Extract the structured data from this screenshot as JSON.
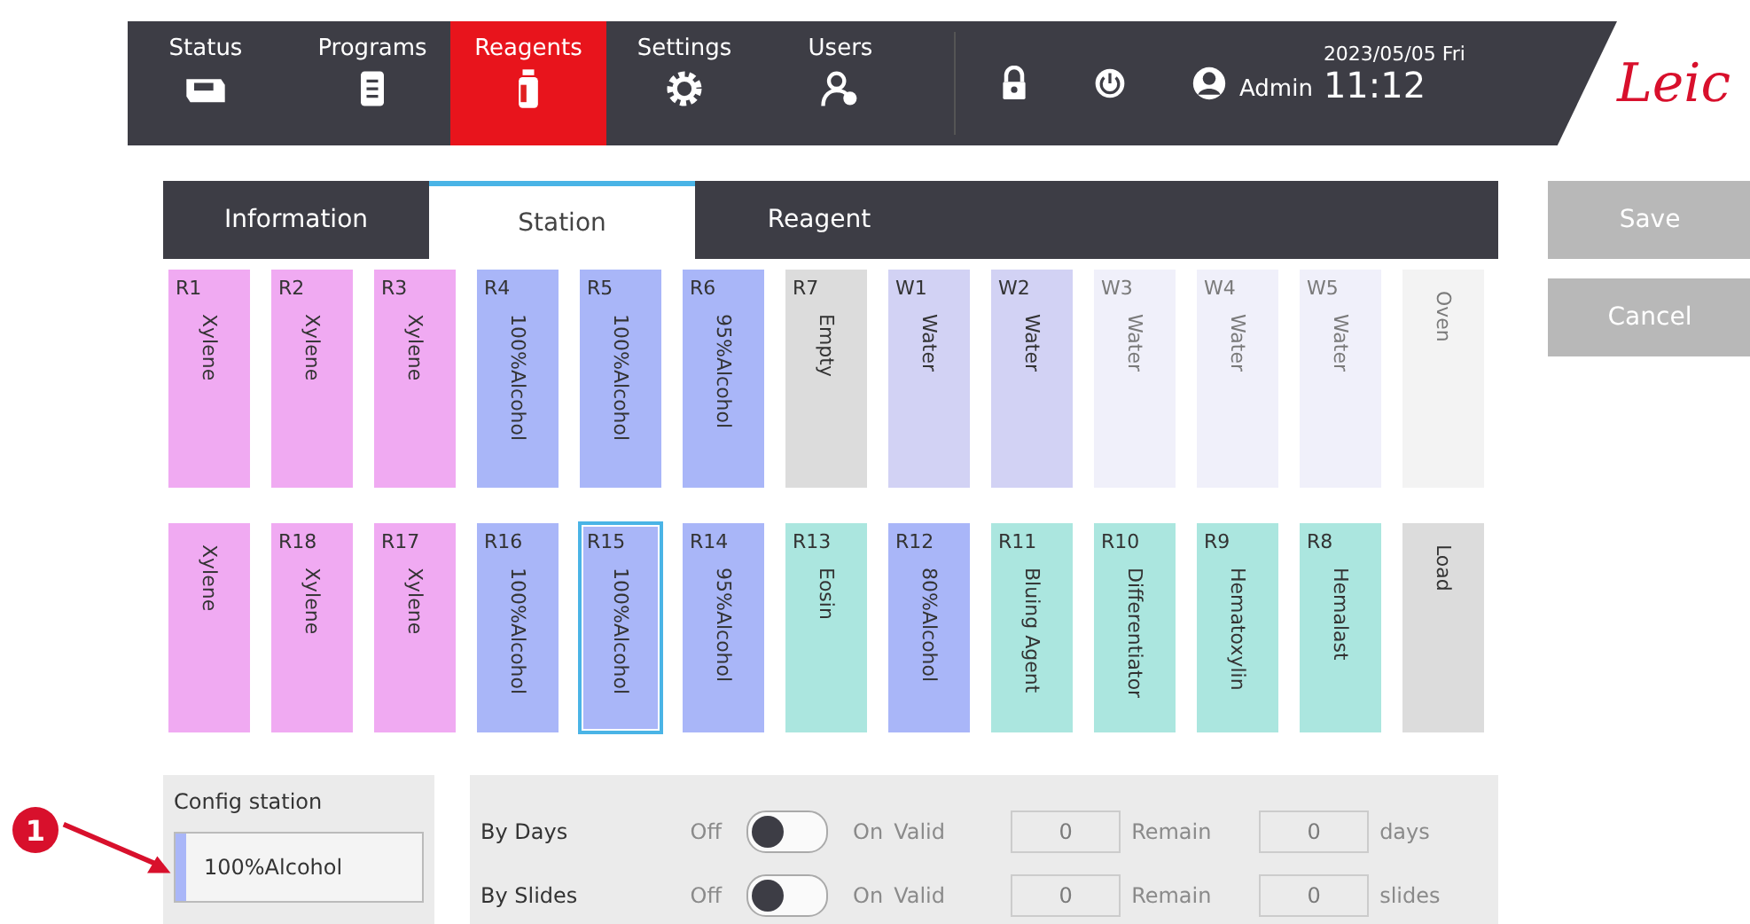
{
  "nav": [
    {
      "label": "Status",
      "selected": false
    },
    {
      "label": "Programs",
      "selected": false
    },
    {
      "label": "Reagents",
      "selected": true
    },
    {
      "label": "Settings",
      "selected": false
    },
    {
      "label": "Users",
      "selected": false
    }
  ],
  "user": "Admin",
  "date": "2023/05/05 Fri",
  "time": "11:12",
  "logo": "Leic",
  "tabs": [
    {
      "label": "Information",
      "selected": false
    },
    {
      "label": "Station",
      "selected": true
    },
    {
      "label": "Reagent",
      "selected": false
    }
  ],
  "buttons": [
    {
      "label": "Save",
      "disabled": true
    },
    {
      "label": "Cancel",
      "disabled": true
    }
  ],
  "stations": [
    [
      {
        "id": "R1",
        "reagent": "Xylene",
        "color": "#f0aaf2",
        "disabled": false,
        "selected": false
      },
      {
        "id": "R2",
        "reagent": "Xylene",
        "color": "#f0aaf2",
        "disabled": false,
        "selected": false
      },
      {
        "id": "R3",
        "reagent": "Xylene",
        "color": "#f0aaf2",
        "disabled": false,
        "selected": false
      },
      {
        "id": "R4",
        "reagent": "100%Alcohol",
        "color": "#a9b6f8",
        "disabled": false,
        "selected": false
      },
      {
        "id": "R5",
        "reagent": "100%Alcohol",
        "color": "#a9b6f8",
        "disabled": false,
        "selected": false
      },
      {
        "id": "R6",
        "reagent": "95%Alcohol",
        "color": "#a9b6f8",
        "disabled": false,
        "selected": false
      },
      {
        "id": "R7",
        "reagent": "Empty",
        "color": "#dcdcdc",
        "disabled": false,
        "selected": false
      },
      {
        "id": "W1",
        "reagent": "Water",
        "color": "#d2d2f4",
        "disabled": false,
        "selected": false
      },
      {
        "id": "W2",
        "reagent": "Water",
        "color": "#d2d2f4",
        "disabled": false,
        "selected": false
      },
      {
        "id": "W3",
        "reagent": "Water",
        "color": "#f0f0fa",
        "disabled": true,
        "selected": false
      },
      {
        "id": "W4",
        "reagent": "Water",
        "color": "#f0f0fa",
        "disabled": true,
        "selected": false
      },
      {
        "id": "W5",
        "reagent": "Water",
        "color": "#f0f0fa",
        "disabled": true,
        "selected": false
      },
      {
        "reagent": "Oven",
        "color": "#f3f3f3",
        "disabled": true,
        "selected": false
      }
    ],
    [
      {
        "reagent": "Xylene",
        "color": "#f0aaf2",
        "disabled": false,
        "selected": false
      },
      {
        "id": "R18",
        "reagent": "Xylene",
        "color": "#f0aaf2",
        "disabled": false,
        "selected": false
      },
      {
        "id": "R17",
        "reagent": "Xylene",
        "color": "#f0aaf2",
        "disabled": false,
        "selected": false
      },
      {
        "id": "R16",
        "reagent": "100%Alcohol",
        "color": "#a9b6f8",
        "disabled": false,
        "selected": false
      },
      {
        "id": "R15",
        "reagent": "100%Alcohol",
        "color": "#a9b6f8",
        "disabled": false,
        "selected": true
      },
      {
        "id": "R14",
        "reagent": "95%Alcohol",
        "color": "#a9b6f8",
        "disabled": false,
        "selected": false
      },
      {
        "id": "R13",
        "reagent": "Eosin",
        "color": "#abe6df",
        "disabled": false,
        "selected": false
      },
      {
        "id": "R12",
        "reagent": "80%Alcohol",
        "color": "#a9b6f8",
        "disabled": false,
        "selected": false
      },
      {
        "id": "R11",
        "reagent": "Bluing Agent",
        "color": "#abe6df",
        "disabled": false,
        "selected": false
      },
      {
        "id": "R10",
        "reagent": "Differentiator",
        "color": "#abe6df",
        "disabled": false,
        "selected": false
      },
      {
        "id": "R9",
        "reagent": "Hematoxylin",
        "color": "#abe6df",
        "disabled": false,
        "selected": false
      },
      {
        "id": "R8",
        "reagent": "Hemalast",
        "color": "#abe6df",
        "disabled": false,
        "selected": false
      },
      {
        "reagent": "Load",
        "color": "#dcdcdc",
        "disabled": false,
        "selected": false
      }
    ]
  ],
  "config": {
    "title": "Config station",
    "value": "100%Alcohol",
    "color": "#a9b6f8"
  },
  "limits": [
    {
      "label": "By Days",
      "off": "Off",
      "on": "On",
      "toggle": false,
      "valid_label": "Valid",
      "valid": "0",
      "remain_label": "Remain",
      "remain": "0",
      "unit": "days"
    },
    {
      "label": "By Slides",
      "off": "Off",
      "on": "On",
      "toggle": false,
      "valid_label": "Valid",
      "valid": "0",
      "remain_label": "Remain",
      "remain": "0",
      "unit": "slides"
    }
  ],
  "callout": "1"
}
